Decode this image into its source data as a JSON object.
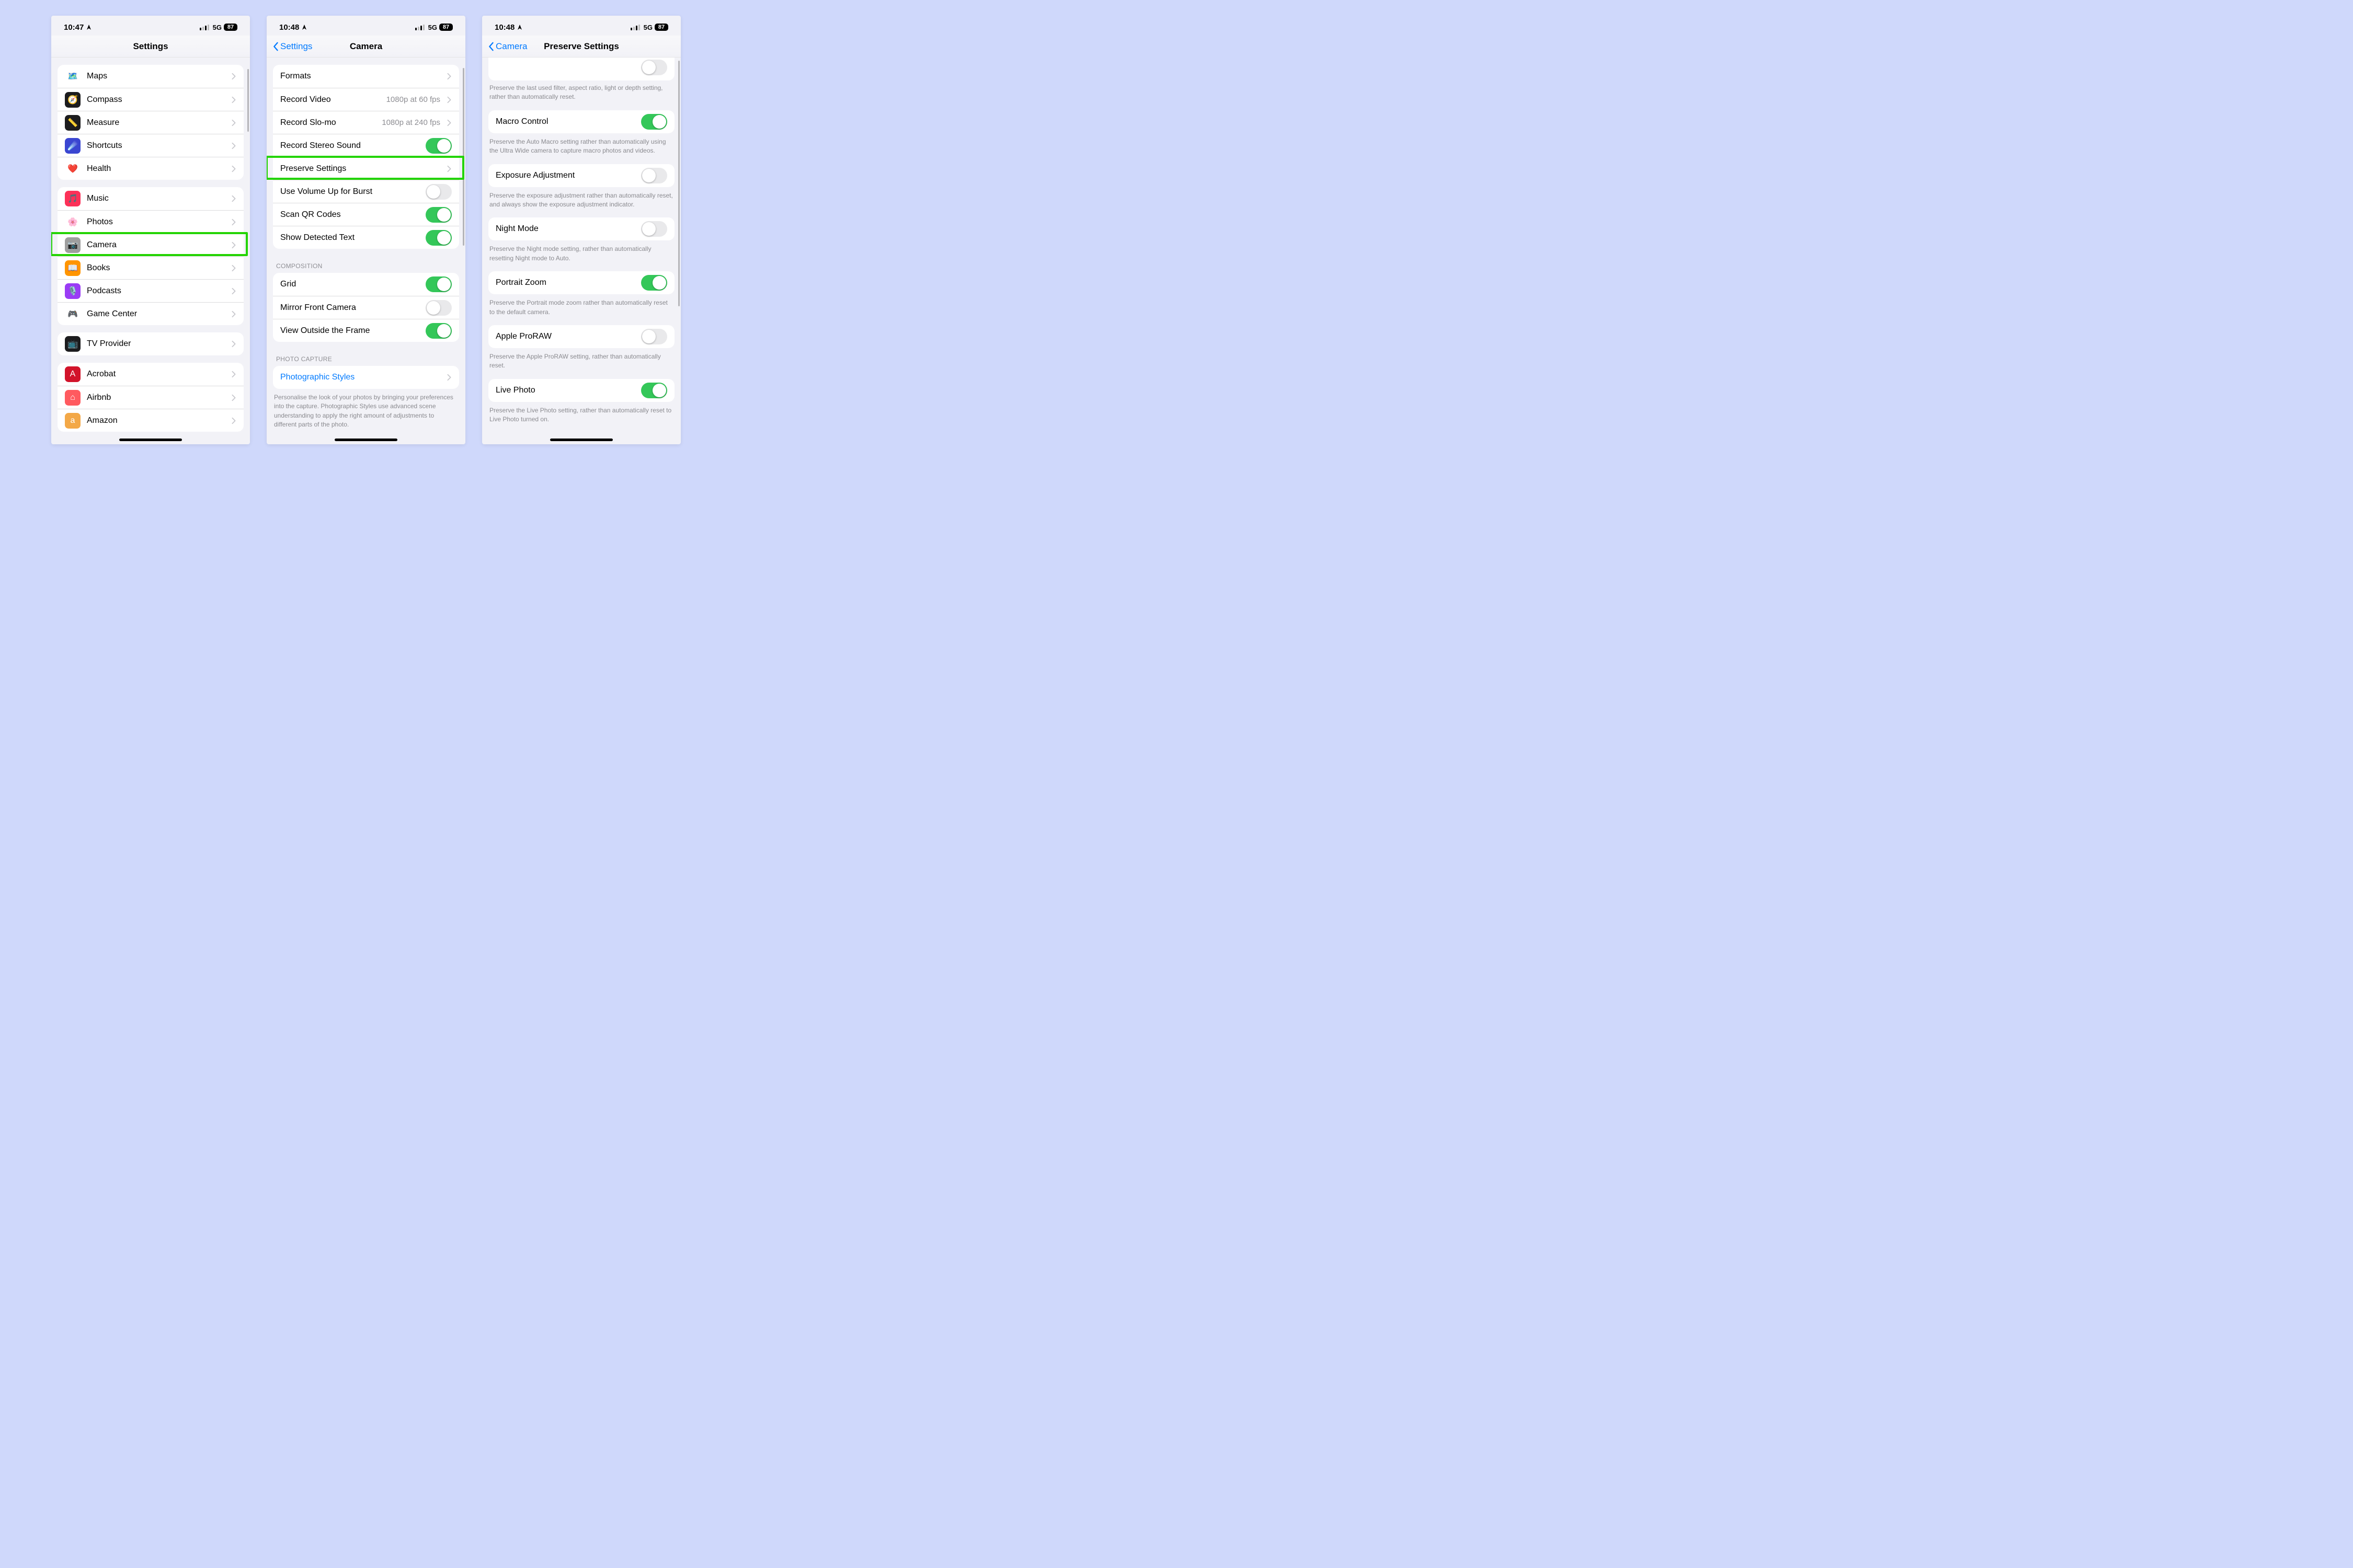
{
  "colors": {
    "ios_blue": "#007aff",
    "ios_green": "#34c759"
  },
  "screen1": {
    "status": {
      "time": "10:47",
      "network": "5G",
      "battery": "87"
    },
    "title": "Settings",
    "groupA": [
      {
        "label": "Maps",
        "iconBg": "#ffffff",
        "glyph": "🗺️"
      },
      {
        "label": "Compass",
        "iconBg": "#1c1c1e",
        "glyph": "🧭"
      },
      {
        "label": "Measure",
        "iconBg": "#1c1c1e",
        "glyph": "📏"
      },
      {
        "label": "Shortcuts",
        "iconBg": "#3a46d1",
        "glyph": "☄️"
      },
      {
        "label": "Health",
        "iconBg": "#ffffff",
        "glyph": "❤️"
      }
    ],
    "groupB": [
      {
        "label": "Music",
        "iconBg": "#fc3158",
        "glyph": "🎵"
      },
      {
        "label": "Photos",
        "iconBg": "#ffffff",
        "glyph": "🌸"
      },
      {
        "label": "Camera",
        "iconBg": "#9e9e9e",
        "glyph": "📷",
        "highlighted": true
      },
      {
        "label": "Books",
        "iconBg": "#ff9500",
        "glyph": "📖"
      },
      {
        "label": "Podcasts",
        "iconBg": "#9a3cf5",
        "glyph": "🎙️"
      },
      {
        "label": "Game Center",
        "iconBg": "#ffffff",
        "glyph": "🎮"
      }
    ],
    "groupC": [
      {
        "label": "TV Provider",
        "iconBg": "#1c1c1e",
        "glyph": "📺"
      }
    ],
    "groupD": [
      {
        "label": "Acrobat",
        "iconBg": "#d2132a",
        "glyph": "A"
      },
      {
        "label": "Airbnb",
        "iconBg": "#ff5a5f",
        "glyph": "⌂"
      },
      {
        "label": "Amazon",
        "iconBg": "#f3a847",
        "glyph": "a"
      }
    ]
  },
  "screen2": {
    "status": {
      "time": "10:48",
      "network": "5G",
      "battery": "87"
    },
    "back": "Settings",
    "title": "Camera",
    "groupA": [
      {
        "label": "Formats",
        "type": "nav"
      },
      {
        "label": "Record Video",
        "type": "nav",
        "detail": "1080p at 60 fps"
      },
      {
        "label": "Record Slo-mo",
        "type": "nav",
        "detail": "1080p at 240 fps"
      },
      {
        "label": "Record Stereo Sound",
        "type": "toggle",
        "on": true
      },
      {
        "label": "Preserve Settings",
        "type": "nav",
        "highlighted": true
      },
      {
        "label": "Use Volume Up for Burst",
        "type": "toggle",
        "on": false
      },
      {
        "label": "Scan QR Codes",
        "type": "toggle",
        "on": true
      },
      {
        "label": "Show Detected Text",
        "type": "toggle",
        "on": true
      }
    ],
    "headerB": "Composition",
    "groupB": [
      {
        "label": "Grid",
        "type": "toggle",
        "on": true
      },
      {
        "label": "Mirror Front Camera",
        "type": "toggle",
        "on": false
      },
      {
        "label": "View Outside the Frame",
        "type": "toggle",
        "on": true
      }
    ],
    "headerC": "Photo Capture",
    "groupC": [
      {
        "label": "Photographic Styles",
        "type": "link-nav"
      }
    ],
    "footerC": "Personalise the look of your photos by bringing your preferences into the capture. Photographic Styles use advanced scene understanding to apply the right amount of adjustments to different parts of the photo."
  },
  "screen3": {
    "status": {
      "time": "10:48",
      "network": "5G",
      "battery": "87"
    },
    "back": "Camera",
    "title": "Preserve Settings",
    "partial_footer": "Preserve the last used filter, aspect ratio, light or depth setting, rather than automatically reset.",
    "items": [
      {
        "label": "Macro Control",
        "on": true,
        "footer": "Preserve the Auto Macro setting rather than automatically using the Ultra Wide camera to capture macro photos and videos."
      },
      {
        "label": "Exposure Adjustment",
        "on": false,
        "footer": "Preserve the exposure adjustment rather than automatically reset, and always show the exposure adjustment indicator."
      },
      {
        "label": "Night Mode",
        "on": false,
        "footer": "Preserve the Night mode setting, rather than automatically resetting Night mode to Auto."
      },
      {
        "label": "Portrait Zoom",
        "on": true,
        "footer": "Preserve the Portrait mode zoom rather than automatically reset to the default camera."
      },
      {
        "label": "Apple ProRAW",
        "on": false,
        "footer": "Preserve the Apple ProRAW setting, rather than automatically reset."
      },
      {
        "label": "Live Photo",
        "on": true,
        "footer": "Preserve the Live Photo setting, rather than automatically reset to Live Photo turned on."
      }
    ]
  }
}
